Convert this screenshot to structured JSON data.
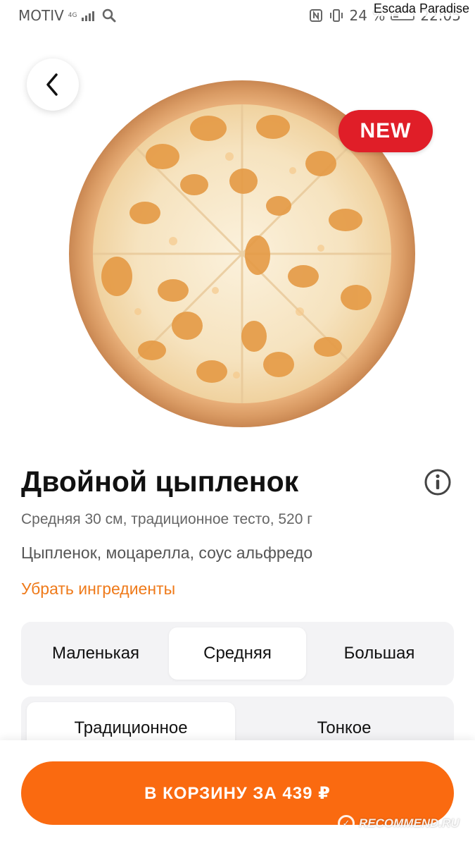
{
  "status_bar": {
    "carrier": "MOTIV",
    "network": "4G",
    "battery": "24 %",
    "time": "22:05"
  },
  "watermark": "Escada Paradise",
  "product": {
    "badge": "NEW",
    "title": "Двойной цыпленок",
    "subtitle": "Средняя 30 см, традиционное тесто, 520 г",
    "ingredients": "Цыпленок, моцарелла, соус альфредо",
    "remove_link": "Убрать ингредиенты"
  },
  "size_options": {
    "small": "Маленькая",
    "medium": "Средняя",
    "large": "Большая",
    "selected": "Средняя"
  },
  "dough_options": {
    "traditional": "Традиционное",
    "thin": "Тонкое",
    "selected": "Традиционное"
  },
  "cart_button": "В КОРЗИНУ ЗА 439 ₽",
  "recommend_watermark": "RECOMMEND.RU",
  "colors": {
    "accent": "#fa6a10",
    "link": "#ef7a1a",
    "badge": "#e01e28",
    "segment_bg": "#f3f3f5"
  }
}
